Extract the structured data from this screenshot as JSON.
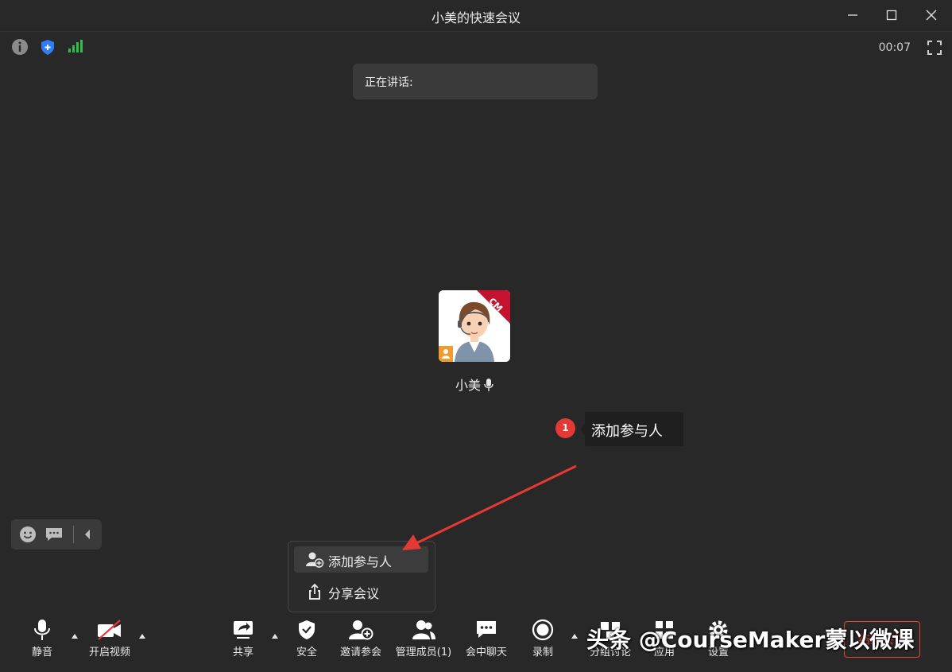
{
  "window": {
    "title": "小美的快速会议"
  },
  "status": {
    "timer": "00:07"
  },
  "speaking": {
    "label": "正在讲话:"
  },
  "participant": {
    "name": "小美",
    "badge": "CM"
  },
  "callout": {
    "number": "1",
    "text": "添加参与人"
  },
  "invite_menu": {
    "items": [
      {
        "label": "添加参与人"
      },
      {
        "label": "分享会议"
      }
    ]
  },
  "toolbar": {
    "mute": "静音",
    "video": "开启视频",
    "share": "共享",
    "security": "安全",
    "invite": "邀请参会",
    "manage": "管理成员(1)",
    "chat": "会中聊天",
    "record": "录制",
    "breakout": "分组讨论",
    "apps": "应用",
    "settings": "设置",
    "end": "结束会议"
  },
  "watermark": "头条 @CourseMaker蒙以微课",
  "colors": {
    "background": "#282828",
    "accent_red": "#e53935",
    "shield_blue": "#2f7df6",
    "signal_green": "#2fbf4a"
  }
}
